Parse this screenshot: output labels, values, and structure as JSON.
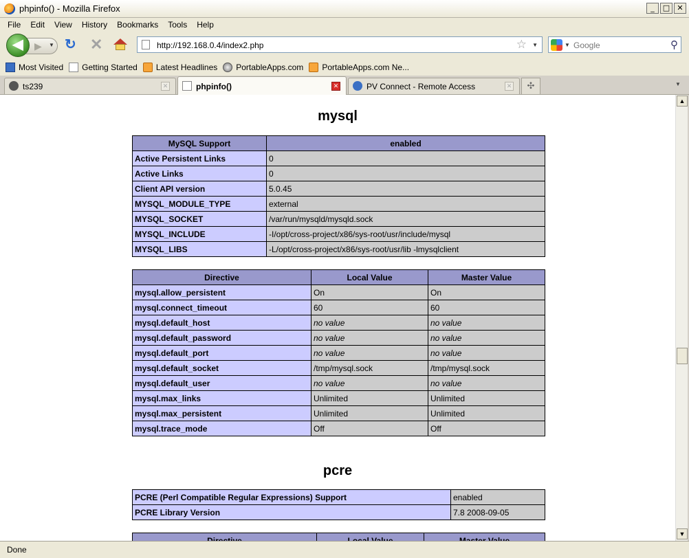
{
  "window": {
    "title": "phpinfo() - Mozilla Firefox",
    "minimize": "_",
    "maximize": "□",
    "close": "✕"
  },
  "menu": [
    "File",
    "Edit",
    "View",
    "History",
    "Bookmarks",
    "Tools",
    "Help"
  ],
  "nav": {
    "url": "http://192.168.0.4/index2.php",
    "search_placeholder": "Google"
  },
  "bookmarks": [
    {
      "label": "Most Visited",
      "icon": "most-visited-icon"
    },
    {
      "label": "Getting Started",
      "icon": "page-icon"
    },
    {
      "label": "Latest Headlines",
      "icon": "rss-icon"
    },
    {
      "label": "PortableApps.com",
      "icon": "portableapps-icon"
    },
    {
      "label": "PortableApps.com Ne...",
      "icon": "rss-icon"
    }
  ],
  "tabs": [
    {
      "label": "ts239"
    },
    {
      "label": "phpinfo()"
    },
    {
      "label": "PV Connect - Remote Access"
    }
  ],
  "mysql": {
    "title": "mysql",
    "support_header": [
      "MySQL Support",
      "enabled"
    ],
    "support_rows": [
      [
        "Active Persistent Links",
        "0"
      ],
      [
        "Active Links",
        "0"
      ],
      [
        "Client API version",
        "5.0.45"
      ],
      [
        "MYSQL_MODULE_TYPE",
        "external"
      ],
      [
        "MYSQL_SOCKET",
        "/var/run/mysqld/mysqld.sock"
      ],
      [
        "MYSQL_INCLUDE",
        "-I/opt/cross-project/x86/sys-root/usr/include/mysql"
      ],
      [
        "MYSQL_LIBS",
        "-L/opt/cross-project/x86/sys-root/usr/lib -lmysqlclient"
      ]
    ],
    "directive_header": [
      "Directive",
      "Local Value",
      "Master Value"
    ],
    "directive_rows": [
      [
        "mysql.allow_persistent",
        "On",
        "On"
      ],
      [
        "mysql.connect_timeout",
        "60",
        "60"
      ],
      [
        "mysql.default_host",
        "no value",
        "no value"
      ],
      [
        "mysql.default_password",
        "no value",
        "no value"
      ],
      [
        "mysql.default_port",
        "no value",
        "no value"
      ],
      [
        "mysql.default_socket",
        "/tmp/mysql.sock",
        "/tmp/mysql.sock"
      ],
      [
        "mysql.default_user",
        "no value",
        "no value"
      ],
      [
        "mysql.max_links",
        "Unlimited",
        "Unlimited"
      ],
      [
        "mysql.max_persistent",
        "Unlimited",
        "Unlimited"
      ],
      [
        "mysql.trace_mode",
        "Off",
        "Off"
      ]
    ]
  },
  "pcre": {
    "title": "pcre",
    "rows": [
      [
        "PCRE (Perl Compatible Regular Expressions) Support",
        "enabled"
      ],
      [
        "PCRE Library Version",
        "7.8 2008-09-05"
      ]
    ],
    "directive_header": [
      "Directive",
      "Local Value",
      "Master Value"
    ]
  },
  "status": "Done"
}
